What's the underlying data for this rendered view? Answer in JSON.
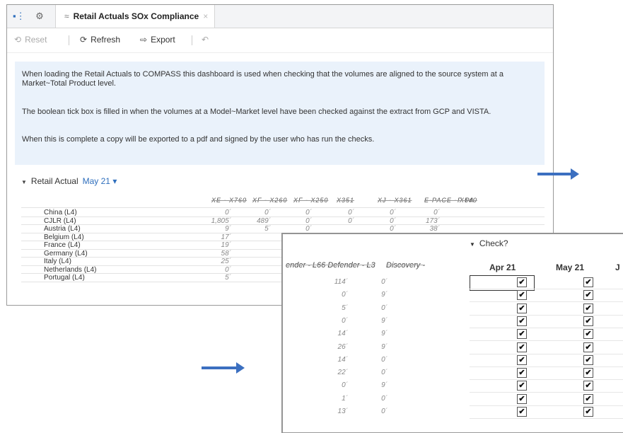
{
  "tab": {
    "title": "Retail Actuals SOx Compliance",
    "chevron": "≈",
    "close": "×"
  },
  "toolbar": {
    "reset": "Reset",
    "refresh": "Refresh",
    "export": "Export",
    "undo_icon": "undo-icon"
  },
  "info": {
    "p1": "When loading the Retail Actuals to COMPASS this dashboard is used when checking that the volumes are aligned to the source system at a Market~Total Product level.",
    "p2": "The boolean tick box is filled in when the volumes at a Model~Market level have been checked against the extract from GCP and VISTA.",
    "p3": "When this is complete a copy will be exported to a pdf and signed by the user who has run the checks."
  },
  "section": {
    "label": "Retail Actual",
    "period": "May 21",
    "caret": "▼",
    "period_caret": "▾"
  },
  "grid": {
    "columns": [
      "XE - X760",
      "XF - X260",
      "XF - X250",
      "X351",
      "XJ - X361",
      "E-PACE - X540",
      "F-PA"
    ],
    "rows": [
      {
        "label": "China (L4)",
        "values": [
          "0",
          "0",
          "0",
          "0",
          "0",
          "0"
        ]
      },
      {
        "label": "CJLR (L4)",
        "values": [
          "1,805",
          "489",
          "0",
          "0",
          "0",
          "173"
        ]
      },
      {
        "label": "Austria (L4)",
        "values": [
          "9",
          "5",
          "0",
          "",
          "0",
          "38"
        ]
      },
      {
        "label": "Belgium (L4)",
        "values": [
          "17",
          "",
          "",
          "",
          "",
          ""
        ]
      },
      {
        "label": "France (L4)",
        "values": [
          "19",
          "",
          "",
          "",
          "",
          ""
        ]
      },
      {
        "label": "Germany (L4)",
        "values": [
          "58",
          "",
          "",
          "",
          "",
          ""
        ]
      },
      {
        "label": "Italy (L4)",
        "values": [
          "25",
          "",
          "",
          "",
          "",
          ""
        ]
      },
      {
        "label": "Netherlands (L4)",
        "values": [
          "0",
          "",
          "",
          "",
          "",
          ""
        ]
      },
      {
        "label": "Portugal (L4)",
        "values": [
          "5",
          "",
          "",
          "",
          "",
          ""
        ]
      }
    ]
  },
  "zoom": {
    "section_label": "Check?",
    "section_caret": "▼",
    "col1": "ender - L66 Defender - L3",
    "col2": "Discovery -",
    "months": [
      "Apr 21",
      "May 21",
      "J"
    ],
    "rows": [
      {
        "a": "114",
        "b": "0",
        "checked_apr": true,
        "checked_may": true
      },
      {
        "a": "0",
        "b": "9",
        "checked_apr": true,
        "checked_may": true
      },
      {
        "a": "5",
        "b": "0",
        "checked_apr": true,
        "checked_may": true
      },
      {
        "a": "0",
        "b": "9",
        "checked_apr": true,
        "checked_may": true
      },
      {
        "a": "14",
        "b": "9",
        "checked_apr": true,
        "checked_may": true
      },
      {
        "a": "26",
        "b": "9",
        "checked_apr": true,
        "checked_may": true
      },
      {
        "a": "14",
        "b": "0",
        "checked_apr": true,
        "checked_may": true
      },
      {
        "a": "22",
        "b": "0",
        "checked_apr": true,
        "checked_may": true
      },
      {
        "a": "0",
        "b": "9",
        "checked_apr": true,
        "checked_may": true
      },
      {
        "a": "1",
        "b": "0",
        "checked_apr": true,
        "checked_may": true
      },
      {
        "a": "13",
        "b": "0",
        "checked_apr": true,
        "checked_may": true
      }
    ],
    "check_glyph": "✔"
  },
  "colors": {
    "accent": "#2f6fbd",
    "info_bg": "#eaf2fb",
    "arrow": "#3b6fc0"
  }
}
